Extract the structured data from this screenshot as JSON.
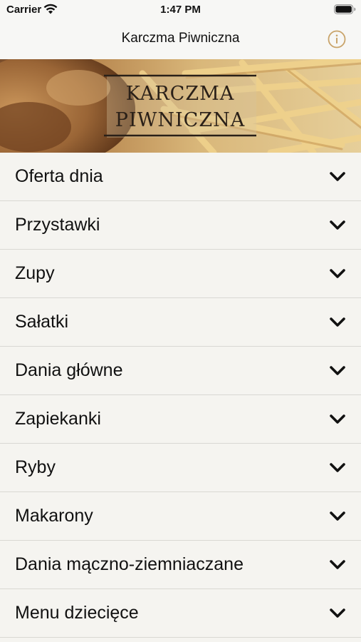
{
  "status_bar": {
    "carrier": "Carrier",
    "time": "1:47 PM",
    "wifi_icon": "wifi-icon",
    "battery_icon": "battery-icon"
  },
  "nav": {
    "title": "Karczma Piwniczna",
    "info_icon": "info-circle-icon",
    "accent_color": "#c9a46a"
  },
  "banner": {
    "logo_line1": "KARCZMA",
    "logo_line2": "PIWNICZNA",
    "description": "banner photo of roasted meat and french fries with restaurant name logo"
  },
  "menu": {
    "chevron_icon": "chevron-down-icon",
    "items": [
      {
        "label": "Oferta dnia"
      },
      {
        "label": "Przystawki"
      },
      {
        "label": "Zupy"
      },
      {
        "label": "Sałatki"
      },
      {
        "label": "Dania główne"
      },
      {
        "label": "Zapiekanki"
      },
      {
        "label": "Ryby"
      },
      {
        "label": "Makarony"
      },
      {
        "label": "Dania mączno-ziemniaczane"
      },
      {
        "label": "Menu dziecięce"
      }
    ]
  }
}
